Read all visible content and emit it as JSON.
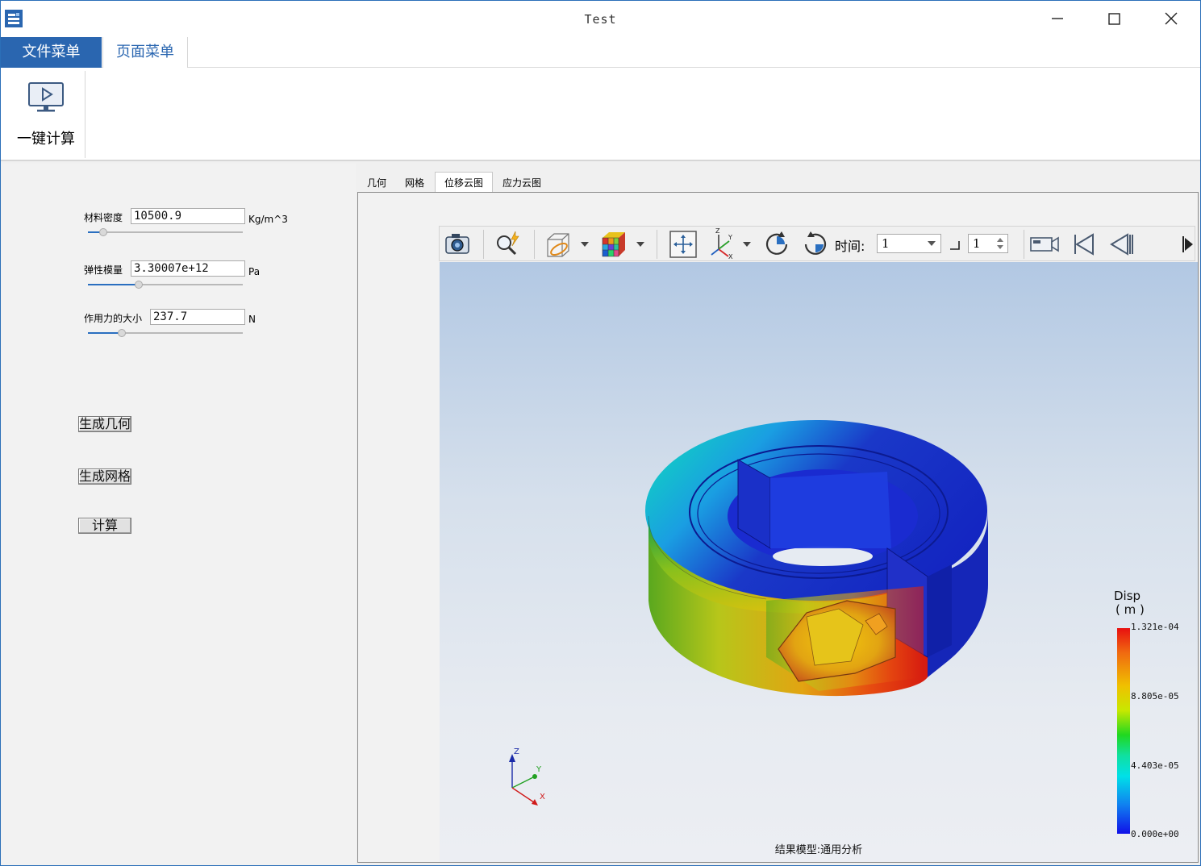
{
  "window": {
    "title": "Test"
  },
  "ribbon": {
    "tabs": [
      "文件菜单",
      "页面菜单"
    ],
    "buttons": [
      {
        "label": "一键计算",
        "icon": "monitor-play-icon"
      }
    ]
  },
  "params": {
    "density": {
      "label": "材料密度",
      "value": "10500.9",
      "unit": "Kg/m^3",
      "slider": 0.1
    },
    "modulus": {
      "label": "弹性模量",
      "value": "3.30007e+12",
      "unit": "Pa",
      "slider": 0.33
    },
    "force": {
      "label": "作用力的大小",
      "value": "237.7",
      "unit": "N",
      "slider": 0.22
    }
  },
  "actions": {
    "gen_geometry": "生成几何",
    "gen_mesh": "生成网格",
    "compute": "计算"
  },
  "view_tabs": [
    "几何",
    "网格",
    "位移云图",
    "应力云图"
  ],
  "active_view_tab": "位移云图",
  "toolbar": {
    "icons": [
      "camera-icon",
      "query-icon",
      "section-icon",
      "colormap-cube-icon",
      "fit-view-icon",
      "axes-view-icon",
      "rotate-cw-icon",
      "rotate-ccw-icon",
      "video-icon",
      "first-frame-icon",
      "prev-frame-icon",
      "next-frame-icon"
    ],
    "time_label": "时间:",
    "time_value": "1",
    "step_value": "1"
  },
  "viewport": {
    "result_model": "结果模型:通用分析",
    "legend": {
      "title": "Disp",
      "unit": "( m )",
      "ticks": [
        "1.321e-04",
        "8.805e-05",
        "4.403e-05",
        "0.000e+00"
      ],
      "colors": [
        "#e81010",
        "#f0c000",
        "#20d820",
        "#00e0e8",
        "#1010e8"
      ]
    },
    "triad": {
      "x": "X",
      "y": "Y",
      "z": "Z"
    }
  }
}
